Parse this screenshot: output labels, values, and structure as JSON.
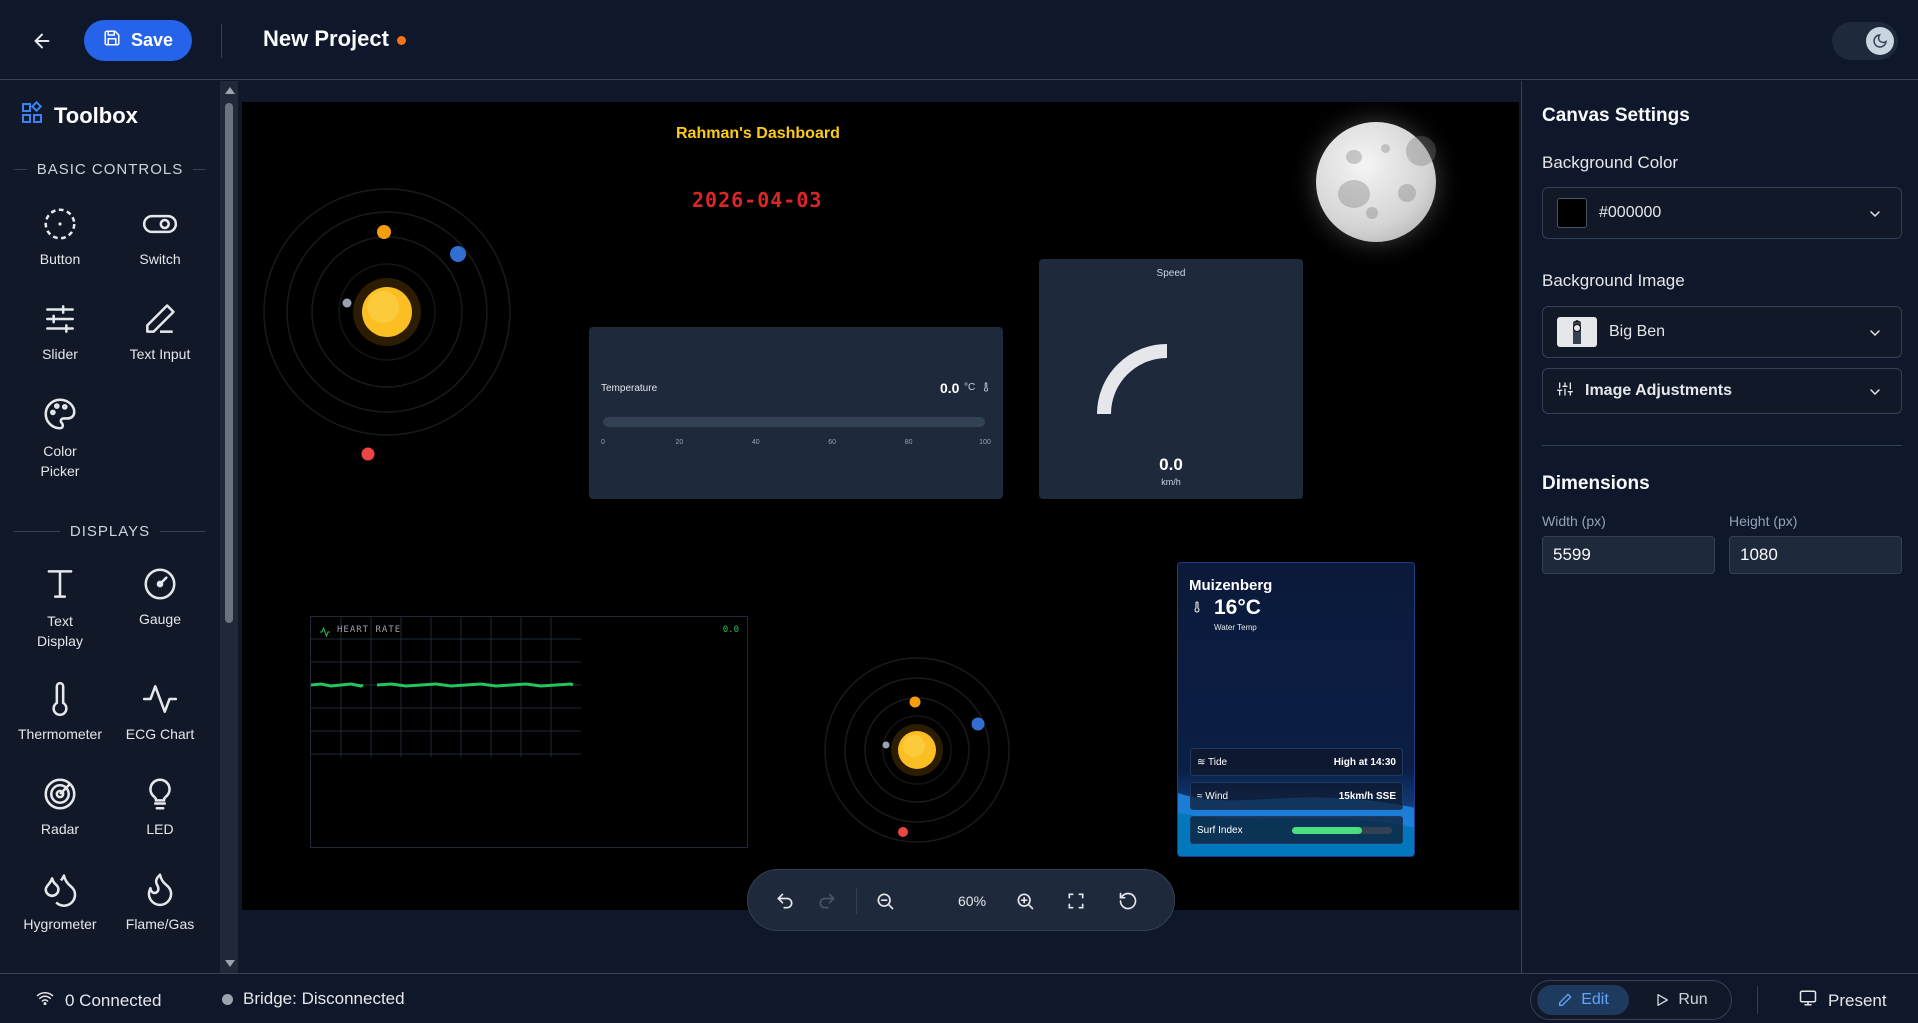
{
  "topbar": {
    "save_label": "Save",
    "project_title": "New Project"
  },
  "toolbox": {
    "title": "Toolbox",
    "sections": [
      {
        "title": "BASIC CONTROLS",
        "items": [
          "Button",
          "Switch",
          "Slider",
          "Text Input",
          "Color Picker"
        ]
      },
      {
        "title": "DISPLAYS",
        "items": [
          "Text Display",
          "Gauge",
          "Thermometer",
          "ECG Chart",
          "Radar",
          "LED",
          "Hygrometer",
          "Flame/Gas"
        ]
      }
    ],
    "icons": {
      "Button": "circle-dashed-icon",
      "Switch": "toggle-icon",
      "Slider": "sliders-icon",
      "Text Input": "pencil-icon",
      "Color Picker": "palette-icon",
      "Text Display": "text-t-icon",
      "Gauge": "gauge-icon",
      "Thermometer": "thermometer-icon",
      "ECG Chart": "activity-icon",
      "Radar": "radar-icon",
      "LED": "lightbulb-icon",
      "Hygrometer": "droplets-icon",
      "Flame/Gas": "flame-icon"
    }
  },
  "canvas": {
    "dashboard_title": "Rahman's Dashboard",
    "date_text": "2026-04-03",
    "background": "#000000",
    "temperature": {
      "label": "Temperature",
      "value": "0.0",
      "unit": "°C",
      "ticks": [
        "0",
        "20",
        "40",
        "60",
        "80",
        "100"
      ],
      "level": 0
    },
    "speed": {
      "label": "Speed",
      "value": "0.0",
      "unit": "km/h"
    },
    "heart_rate": {
      "label": "HEART RATE",
      "value": "0.0"
    },
    "weather": {
      "location": "Muizenberg",
      "temperature": "16°C",
      "sub_label": "Water Temp",
      "rows": [
        {
          "label": "Tide",
          "value": "High at 14:30"
        },
        {
          "label": "Wind",
          "value": "15km/h SSE"
        }
      ],
      "surf_label": "Surf Index",
      "surf_level": 0.7
    }
  },
  "zoom": {
    "level": "60%"
  },
  "settings": {
    "title": "Canvas Settings",
    "bg_color_label": "Background Color",
    "bg_color_value": "#000000",
    "bg_image_label": "Background Image",
    "bg_image_value": "Big Ben",
    "image_adjustments_label": "Image Adjustments",
    "dimensions_title": "Dimensions",
    "width_label": "Width (px)",
    "width_value": "5599",
    "height_label": "Height (px)",
    "height_value": "1080"
  },
  "status": {
    "connected": "0 Connected",
    "bridge": "Bridge: Disconnected",
    "edit_label": "Edit",
    "run_label": "Run",
    "present_label": "Present"
  },
  "colors": {
    "accent": "#2563eb",
    "unsaved": "#f97316",
    "title_yellow": "#facc15",
    "date_red": "#dc2626"
  }
}
